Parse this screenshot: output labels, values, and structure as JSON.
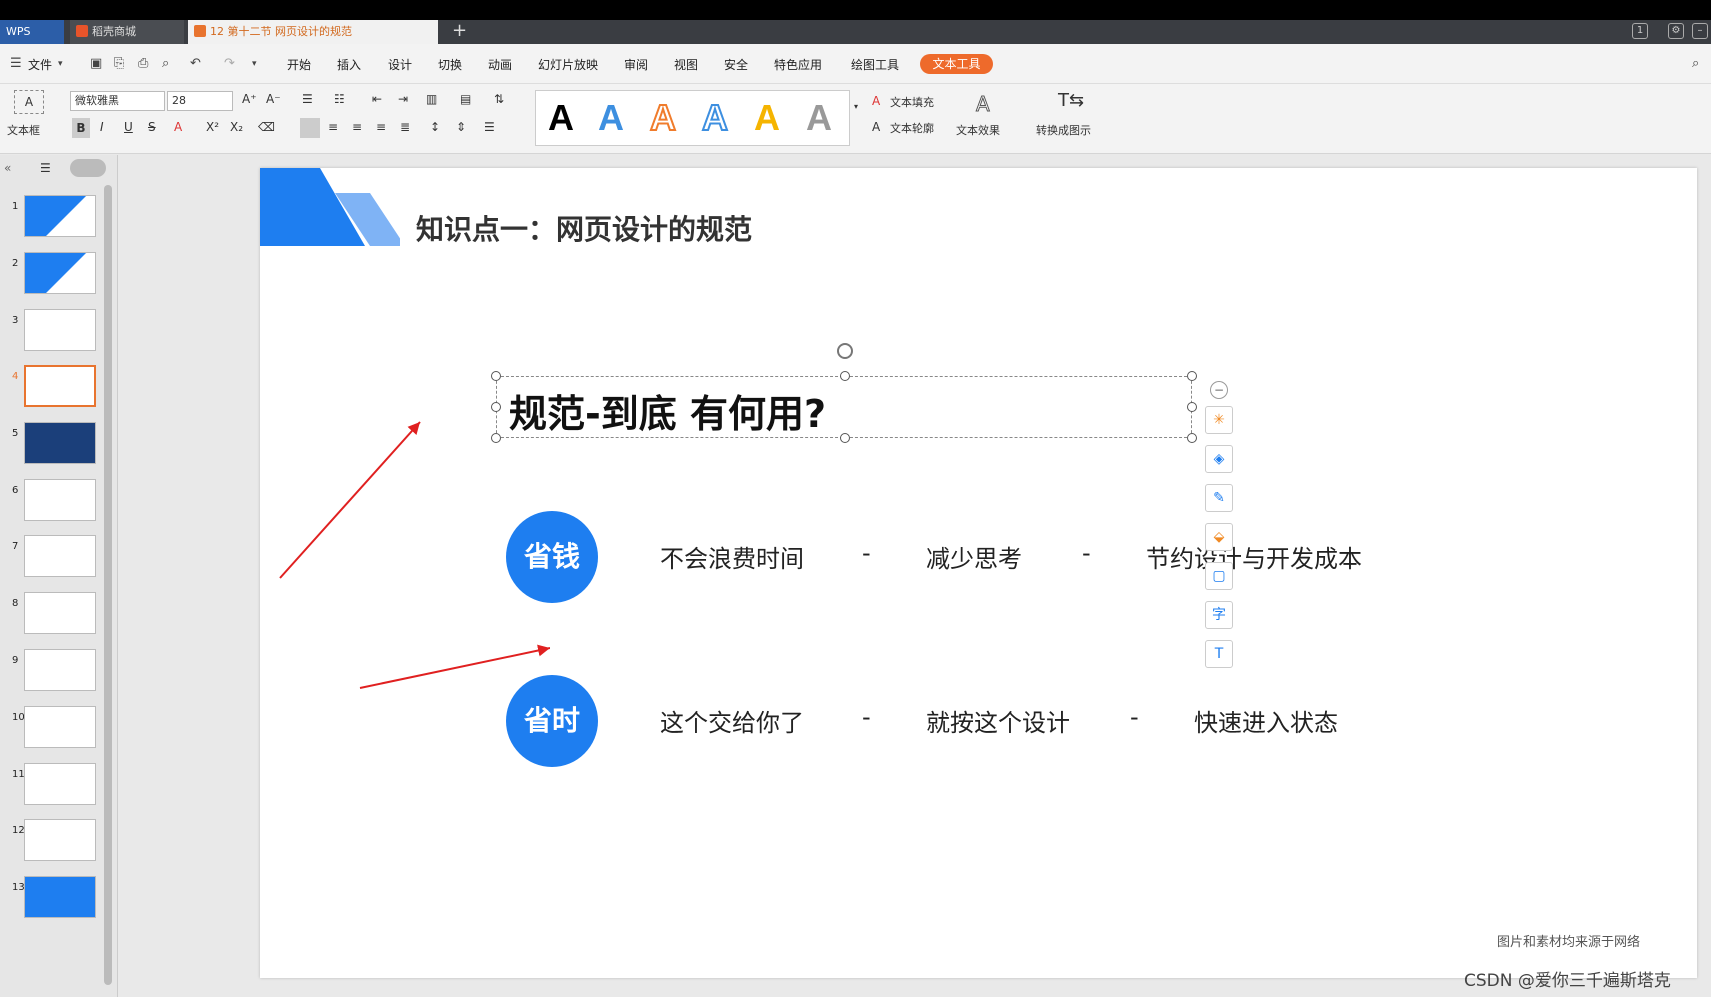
{
  "tabs": {
    "wps": "WPS",
    "shop": "稻壳商城",
    "doc": "12 第十二节 网页设计的规范"
  },
  "menu": {
    "file": "文件",
    "items": [
      "开始",
      "插入",
      "设计",
      "切换",
      "动画",
      "幻灯片放映",
      "审阅",
      "视图",
      "安全",
      "特色应用",
      "绘图工具"
    ],
    "active": "文本工具"
  },
  "ribbon": {
    "textbox": "文本框",
    "font": "微软雅黑",
    "size": "28",
    "fill": "文本填充",
    "outline": "文本轮廓",
    "effect": "文本效果",
    "convert": "转换成图示",
    "wordart_letter": "A"
  },
  "thumbnails": [
    "1",
    "2",
    "3",
    "4",
    "5",
    "6",
    "7",
    "8",
    "9",
    "10",
    "11",
    "12",
    "13"
  ],
  "slide": {
    "header": "知识点一：网页设计的规范",
    "title": "规范-到底 有何用?",
    "row1": {
      "badge": "省钱",
      "a": "不会浪费时间",
      "b": "减少思考",
      "c": "节约设计与开发成本",
      "sep": "-"
    },
    "row2": {
      "badge": "省时",
      "a": "这个交给你了",
      "b": "就按这个设计",
      "c": "快速进入状态",
      "sep": "-"
    },
    "footnote": "图片和素材均来源于网络"
  },
  "watermark": "CSDN @爱你三千遍斯塔克",
  "colors": {
    "accent": "#1e7ef0",
    "tab_active": "#ee6a2b"
  }
}
